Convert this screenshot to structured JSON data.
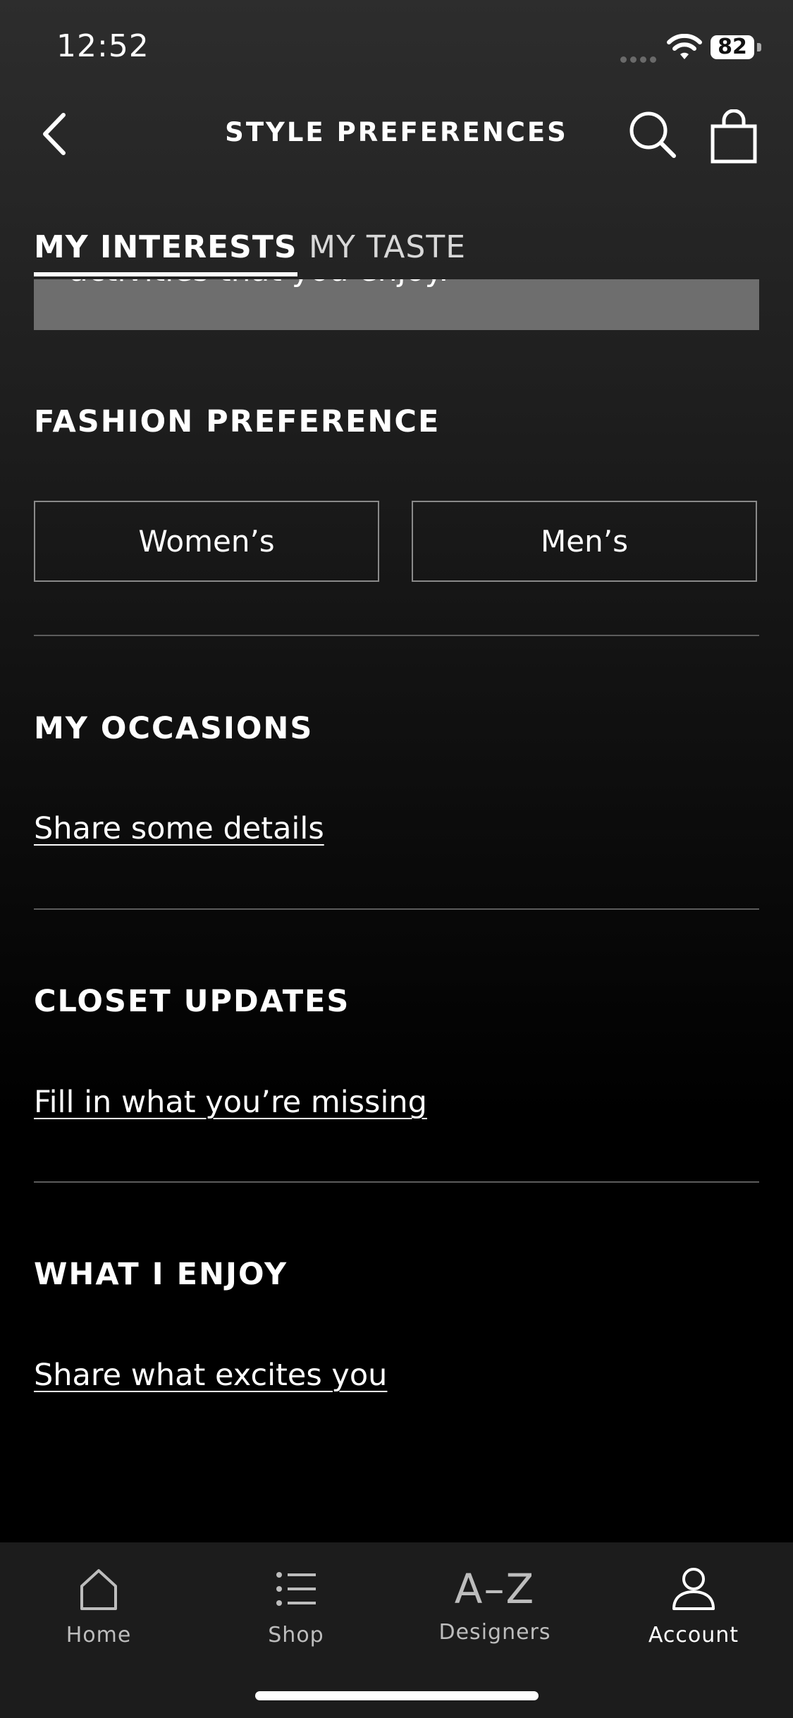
{
  "status_bar": {
    "time": "12:52",
    "battery": "82"
  },
  "header": {
    "title": "STYLE PREFERENCES",
    "back_icon": "chevron-left-icon",
    "search_icon": "search-icon",
    "bag_icon": "shopping-bag-icon"
  },
  "tabs": [
    {
      "label": "MY INTERESTS",
      "active": true
    },
    {
      "label": "MY TASTE",
      "active": false
    }
  ],
  "banner_partial_text": "activities that you enjoy.",
  "sections": {
    "fashion_preference": {
      "title": "FASHION PREFERENCE",
      "options": [
        "Women’s",
        "Men’s"
      ]
    },
    "occasions": {
      "title": "MY OCCASIONS",
      "link": "Share some details"
    },
    "closet": {
      "title": "CLOSET UPDATES",
      "link": "Fill in what you’re missing"
    },
    "enjoy": {
      "title": "WHAT I ENJOY",
      "link": "Share what excites you"
    }
  },
  "tabbar": {
    "items": [
      {
        "label": "Home",
        "icon": "home-icon"
      },
      {
        "label": "Shop",
        "icon": "list-icon"
      },
      {
        "label": "Designers",
        "icon": "a-z-icon",
        "glyph": "A–Z"
      },
      {
        "label": "Account",
        "icon": "account-icon",
        "active": true
      }
    ]
  },
  "colors": {
    "background_top": "#2d2d2d",
    "background_bottom": "#000000",
    "banner": "#6e6e6e",
    "divider": "#5c5c5c",
    "tabbar": "#1c1c1c"
  }
}
